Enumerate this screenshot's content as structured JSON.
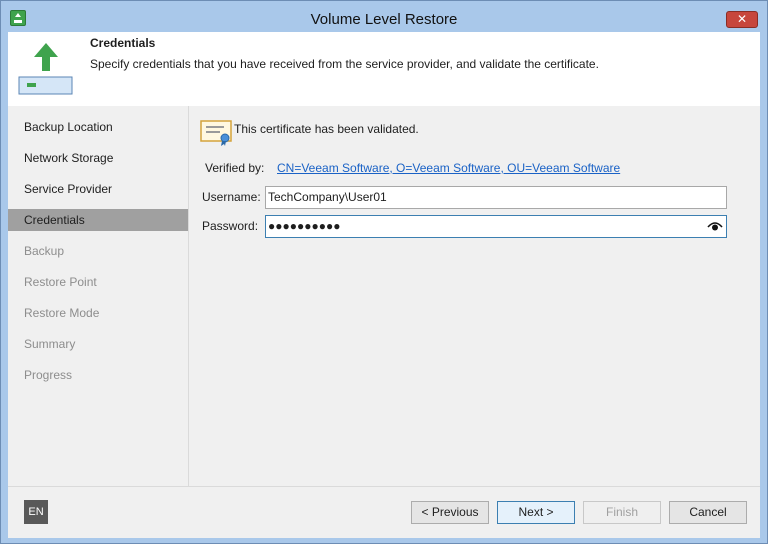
{
  "window": {
    "title": "Volume Level Restore",
    "close_label": "✕"
  },
  "header": {
    "title": "Credentials",
    "description": "Specify credentials that you have received from the service provider, and validate the certificate."
  },
  "sidebar": {
    "steps": [
      {
        "label": "Backup Location",
        "state": "done"
      },
      {
        "label": "Network Storage",
        "state": "done"
      },
      {
        "label": "Service Provider",
        "state": "done"
      },
      {
        "label": "Credentials",
        "state": "active"
      },
      {
        "label": "Backup",
        "state": "pending"
      },
      {
        "label": "Restore Point",
        "state": "pending"
      },
      {
        "label": "Restore Mode",
        "state": "pending"
      },
      {
        "label": "Summary",
        "state": "pending"
      },
      {
        "label": "Progress",
        "state": "pending"
      }
    ]
  },
  "content": {
    "certificate_status": "This certificate has been validated.",
    "verified_by_label": "Verified by:",
    "verified_by_value": "CN=Veeam Software, O=Veeam Software, OU=Veeam Software",
    "username_label": "Username:",
    "username_value": "TechCompany\\User01",
    "password_label": "Password:",
    "password_value": "●●●●●●●●●●"
  },
  "footer": {
    "language": "EN",
    "previous_label": "< Previous",
    "next_label": "Next >",
    "finish_label": "Finish",
    "cancel_label": "Cancel"
  },
  "colors": {
    "titlebar": "#a9c8ea",
    "active_step": "#a0a0a0",
    "link": "#1a62c6",
    "close": "#c7463c",
    "focus_border": "#3c7fb1"
  }
}
